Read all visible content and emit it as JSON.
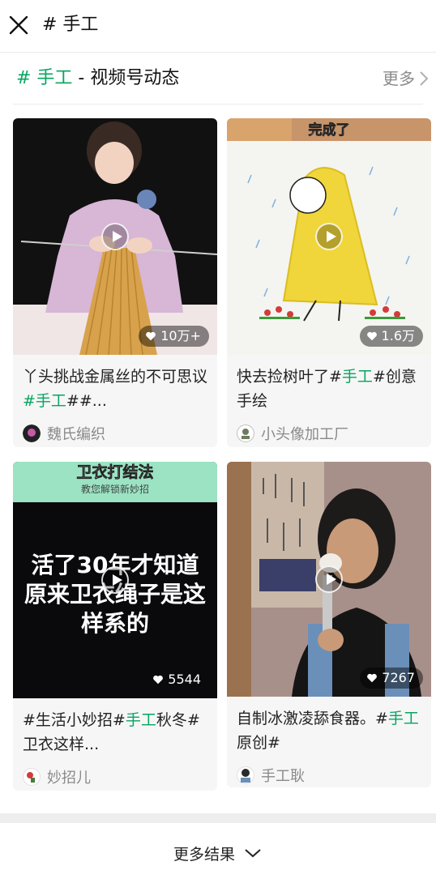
{
  "header": {
    "title": "# 手工"
  },
  "section": {
    "hashtag": "# 手工",
    "suffix": " - 视频号动态",
    "more_label": "更多"
  },
  "cards": [
    {
      "title_pre": "丫头挑战金属丝的不可思议",
      "title_tag": "#手工",
      "title_post": "##...",
      "likes": "10万+",
      "author": "魏氏编织"
    },
    {
      "title_pre": "快去捡树叶了#",
      "title_tag": "手工",
      "title_post": "#创意手绘",
      "likes": "1.6万",
      "author": "小头像加工厂",
      "thumb_caption": "完成了"
    },
    {
      "title_pre": "#生活小妙招#",
      "title_tag": "手工",
      "title_post": "秋冬#卫衣这样...",
      "likes": "5544",
      "author": "妙招儿",
      "thumb_banner": "卫衣打结法",
      "thumb_sub": "教您解锁新妙招",
      "thumb_text": "活了30年才知道原来卫衣绳子是这样系的"
    },
    {
      "title_pre": "自制冰激凌舔食器。#",
      "title_tag": "手工",
      "title_post": "原创#",
      "likes": "7267",
      "author": "手工耿"
    }
  ],
  "footer": {
    "more_results": "更多结果"
  },
  "colors": {
    "accent": "#07a560",
    "muted": "#8a8a8a"
  }
}
